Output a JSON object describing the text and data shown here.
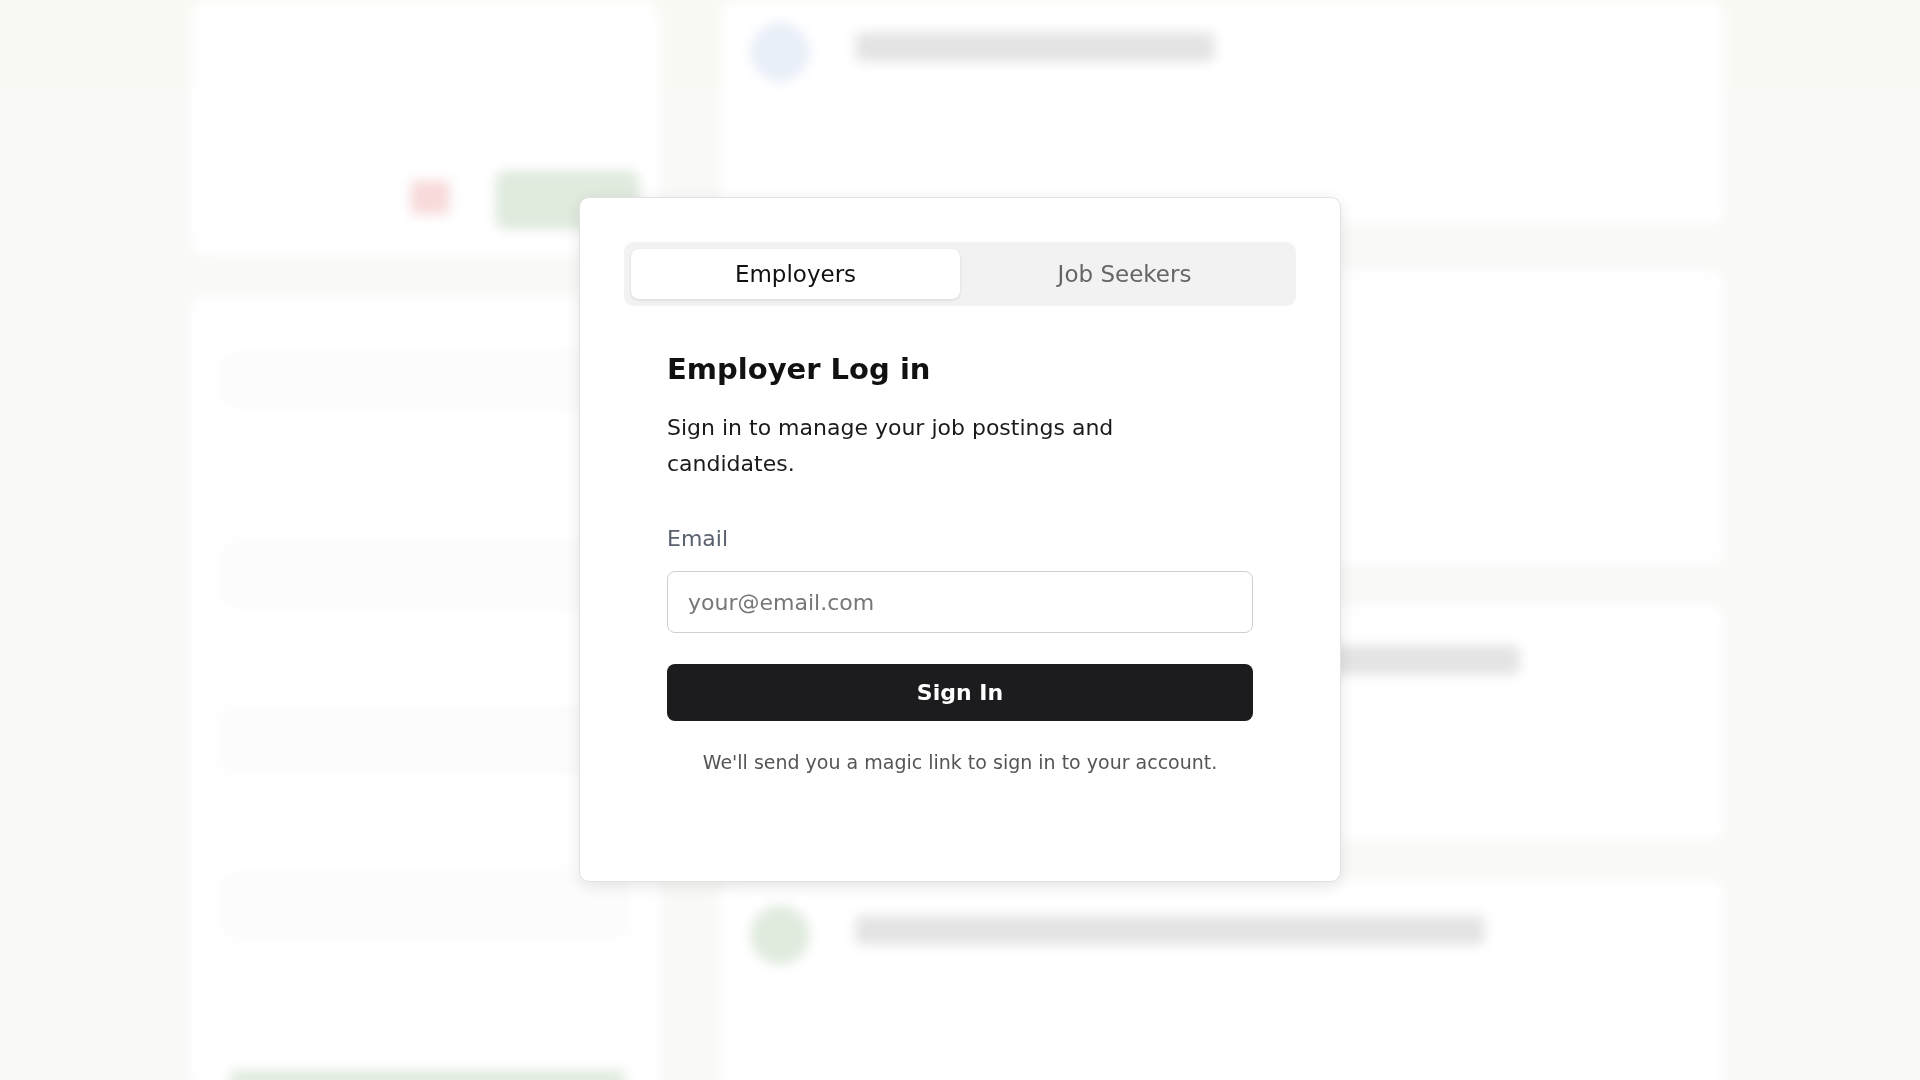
{
  "login_dialog": {
    "tabs": [
      {
        "label": "Employers",
        "selected": true
      },
      {
        "label": "Job Seekers",
        "selected": false
      }
    ],
    "title": "Employer Log in",
    "description": "Sign in to manage your job postings and candidates.",
    "email_field": {
      "label": "Email",
      "placeholder": "your@email.com"
    },
    "submit_button": "Sign In",
    "note": "We'll send you a magic link to sign in to your account."
  }
}
